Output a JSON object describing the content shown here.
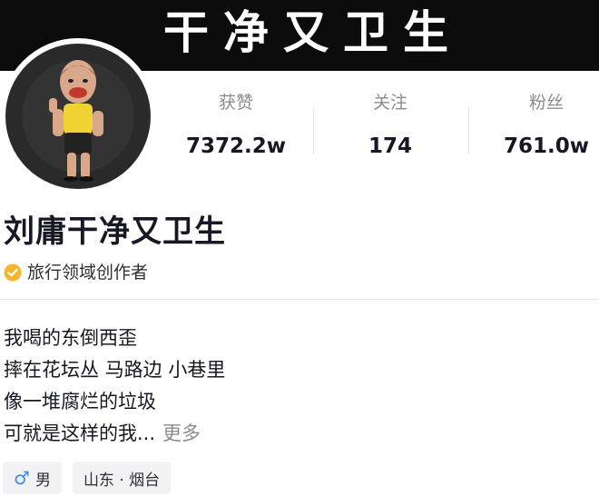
{
  "banner": {
    "title": "干净又卫生"
  },
  "stats": [
    {
      "label": "获赞",
      "value": "7372.2w"
    },
    {
      "label": "关注",
      "value": "174"
    },
    {
      "label": "粉丝",
      "value": "761.0w"
    }
  ],
  "profile": {
    "name": "刘庸干净又卫生",
    "certification": "旅行领域创作者"
  },
  "bio": {
    "lines": [
      "我喝的东倒西歪",
      "摔在花坛丛 马路边 小巷里",
      "像一堆腐烂的垃圾",
      "可就是这样的我..."
    ],
    "more_label": "更多"
  },
  "tags": {
    "gender": "男",
    "location": "山东 · 烟台"
  },
  "colors": {
    "gender_icon": "#3b8df0",
    "verified_badge": "#f5b52c",
    "muted_text": "#8a8b91"
  }
}
